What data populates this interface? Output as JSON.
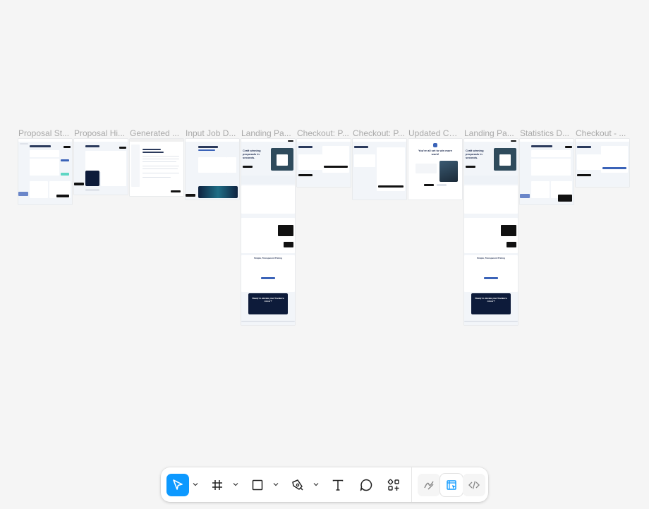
{
  "frames": [
    {
      "title": "Proposal St..."
    },
    {
      "title": "Proposal Hi..."
    },
    {
      "title": "Generated ..."
    },
    {
      "title": "Input Job D..."
    },
    {
      "title": "Landing Pa..."
    },
    {
      "title": "Checkout: P..."
    },
    {
      "title": "Checkout: P..."
    },
    {
      "title": "Updated Ch..."
    },
    {
      "title": "Landing Pa..."
    },
    {
      "title": "Statistics D..."
    },
    {
      "title": "Checkout - ..."
    }
  ],
  "thumb_text": {
    "craft_winning": "Craft winning proposals in seconds.",
    "pricing": "Simple, Transparent Pricing",
    "cta": "Ready to elevate your freelance career?",
    "win_more": "You're all set to win more work!"
  },
  "toolbar": {
    "tools": [
      {
        "icon": "move-cursor-icon",
        "active": true
      },
      {
        "icon": "frame-grid-icon"
      },
      {
        "icon": "rectangle-icon"
      },
      {
        "icon": "pen-icon"
      },
      {
        "icon": "text-icon"
      },
      {
        "icon": "comment-icon"
      },
      {
        "icon": "actions-icon"
      }
    ],
    "modes": [
      {
        "icon": "draw-mode-icon"
      },
      {
        "icon": "design-mode-icon",
        "selected": true
      },
      {
        "icon": "dev-mode-icon"
      }
    ]
  },
  "colors": {
    "accent": "#0d99ff",
    "canvas_bg": "#f5f5f5"
  }
}
